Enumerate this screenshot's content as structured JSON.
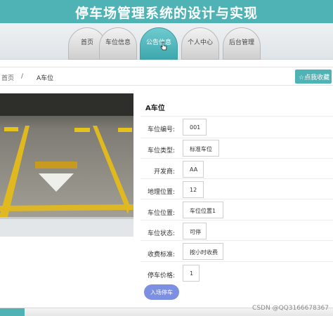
{
  "header": {
    "title": "停车场管理系统的设计与实现"
  },
  "nav": {
    "tabs": [
      {
        "label": "首页"
      },
      {
        "label": "车位信息"
      },
      {
        "label": "公告信息"
      },
      {
        "label": "个人中心"
      },
      {
        "label": "后台管理"
      }
    ],
    "active_index": 2
  },
  "breadcrumb": {
    "home": "首页",
    "separator": "/",
    "current": "A车位"
  },
  "actions": {
    "collect_label": "☆点我收藏"
  },
  "detail": {
    "title": "A车位",
    "fields": [
      {
        "label": "车位编号:",
        "value": "001"
      },
      {
        "label": "车位类型:",
        "value": "标准车位"
      },
      {
        "label": "开发商:",
        "value": "AA"
      },
      {
        "label": "地理位置:",
        "value": "12"
      },
      {
        "label": "车位位置:",
        "value": "车位位置1"
      },
      {
        "label": "车位状态:",
        "value": "可停"
      },
      {
        "label": "收费标准:",
        "value": "按小时收费"
      },
      {
        "label": "停车价格:",
        "value": "1"
      }
    ],
    "enter_button": "入场停车"
  },
  "watermark": "CSDN @QQ3166678367",
  "colors": {
    "accent": "#4fb3b6",
    "button": "#7d8fe0"
  }
}
